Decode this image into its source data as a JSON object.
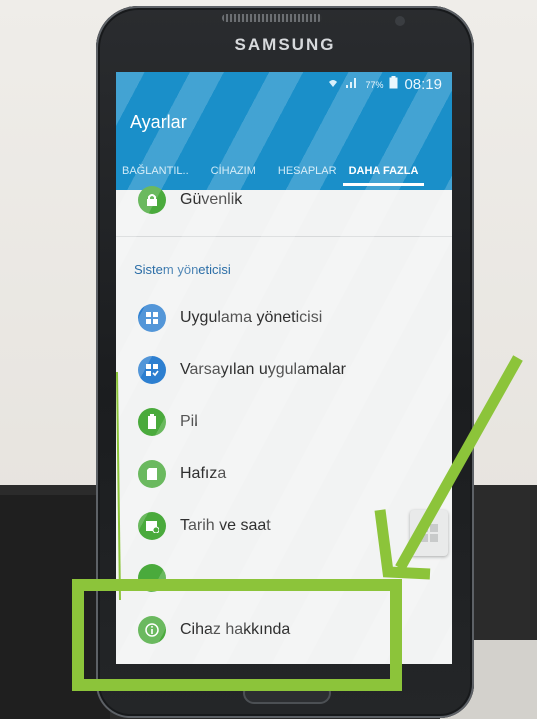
{
  "device": {
    "brand": "SAMSUNG"
  },
  "status_bar": {
    "battery_percent": "77%",
    "time": "08:19"
  },
  "app": {
    "title": "Ayarlar"
  },
  "tabs": [
    {
      "label": "BAĞLANTIL..",
      "active": false
    },
    {
      "label": "CİHAZIM",
      "active": false
    },
    {
      "label": "HESAPLAR",
      "active": false
    },
    {
      "label": "DAHA FAZLA",
      "active": true
    }
  ],
  "list": {
    "top_item": {
      "label": "Güvenlik",
      "icon": "lock-icon"
    },
    "section_header": "Sistem yöneticisi",
    "items": [
      {
        "label": "Uygulama yöneticisi",
        "icon": "apps-grid-icon",
        "color": "#2d7fd0"
      },
      {
        "label": "Varsayılan uygulamalar",
        "icon": "default-apps-icon",
        "color": "#2d7fd0"
      },
      {
        "label": "Pil",
        "icon": "battery-icon",
        "color": "#4aaa3c"
      },
      {
        "label": "Hafıza",
        "icon": "storage-icon",
        "color": "#4aaa3c"
      },
      {
        "label": "Tarih ve saat",
        "icon": "calendar-clock-icon",
        "color": "#4aaa3c"
      },
      {
        "label": "",
        "icon": "accessibility-icon",
        "color": "#4aaa3c"
      },
      {
        "label": "Cihaz hakkında",
        "icon": "info-icon",
        "color": "#4aaa3c"
      }
    ]
  },
  "annotation": {
    "color": "#8cc43a"
  }
}
